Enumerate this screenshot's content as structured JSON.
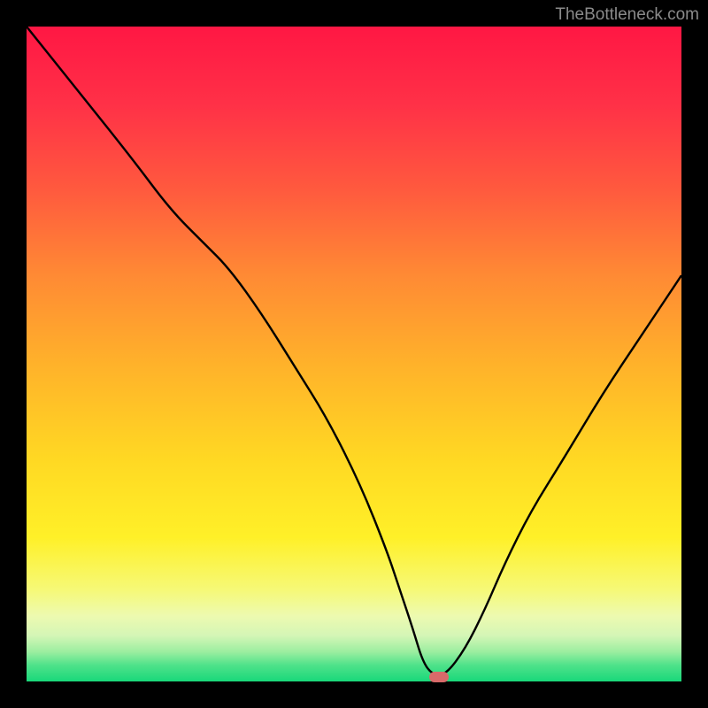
{
  "attribution": "TheBottleneck.com",
  "chart_data": {
    "type": "line",
    "title": "",
    "xlabel": "",
    "ylabel": "",
    "xlim": [
      0,
      100
    ],
    "ylim": [
      0,
      100
    ],
    "series": [
      {
        "name": "bottleneck-curve",
        "x": [
          0,
          8,
          16,
          22,
          27,
          31,
          36,
          41,
          46,
          51,
          55,
          57,
          59,
          60.5,
          62,
          64,
          67,
          70,
          73,
          77,
          82,
          88,
          94,
          100
        ],
        "y": [
          100,
          90,
          80,
          72,
          67,
          63,
          56,
          48,
          40,
          30,
          20,
          14,
          8,
          3,
          1,
          1,
          5,
          11,
          18,
          26,
          34,
          44,
          53,
          62
        ]
      }
    ],
    "marker": {
      "x": 63,
      "y": 0.7
    },
    "gradient_stops": [
      {
        "offset": 0.0,
        "color": "#ff1744"
      },
      {
        "offset": 0.12,
        "color": "#ff3147"
      },
      {
        "offset": 0.25,
        "color": "#ff5a3e"
      },
      {
        "offset": 0.38,
        "color": "#ff8a34"
      },
      {
        "offset": 0.52,
        "color": "#ffb32a"
      },
      {
        "offset": 0.66,
        "color": "#ffd823"
      },
      {
        "offset": 0.78,
        "color": "#fff028"
      },
      {
        "offset": 0.86,
        "color": "#f6f977"
      },
      {
        "offset": 0.9,
        "color": "#edfab0"
      },
      {
        "offset": 0.93,
        "color": "#d4f6b6"
      },
      {
        "offset": 0.955,
        "color": "#9beea0"
      },
      {
        "offset": 0.975,
        "color": "#4fe28a"
      },
      {
        "offset": 1.0,
        "color": "#19d87a"
      }
    ]
  }
}
